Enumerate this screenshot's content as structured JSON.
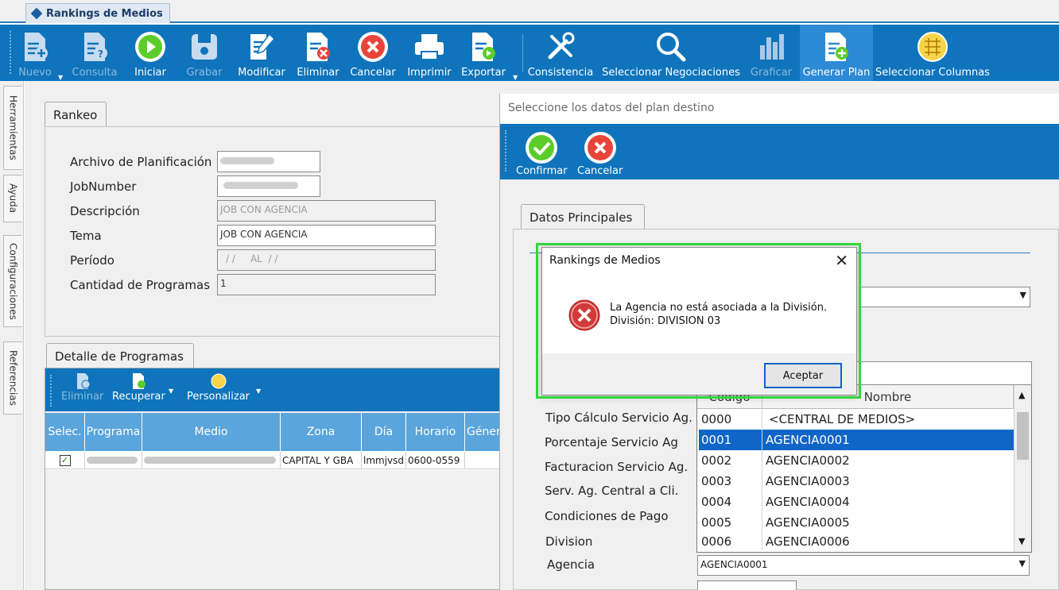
{
  "document_tab": {
    "title": "Rankings de Medios"
  },
  "toolbar": {
    "buttons": [
      {
        "label": "Nuevo",
        "icon": "new-document-icon",
        "enabled": false
      },
      {
        "label": "Consulta",
        "icon": "query-document-icon",
        "enabled": false
      },
      {
        "label": "Iniciar",
        "icon": "play-icon",
        "enabled": true
      },
      {
        "label": "Grabar",
        "icon": "save-disk-icon",
        "enabled": false
      },
      {
        "label": "Modificar",
        "icon": "edit-document-icon",
        "enabled": true
      },
      {
        "label": "Eliminar",
        "icon": "delete-document-icon",
        "enabled": true
      },
      {
        "label": "Cancelar",
        "icon": "cancel-x-icon",
        "enabled": true
      },
      {
        "label": "Imprimir",
        "icon": "printer-icon",
        "enabled": true
      },
      {
        "label": "Exportar",
        "icon": "export-document-icon",
        "enabled": true
      },
      {
        "label": "Consistencia",
        "icon": "tools-icon",
        "enabled": true
      },
      {
        "label": "Seleccionar Negociaciones",
        "icon": "magnifier-icon",
        "enabled": true
      },
      {
        "label": "Graficar",
        "icon": "bar-chart-icon",
        "enabled": false
      },
      {
        "label": "Generar Plan",
        "icon": "generate-plan-icon",
        "enabled": true
      },
      {
        "label": "Seleccionar Columnas",
        "icon": "columns-grid-icon",
        "enabled": true
      }
    ]
  },
  "side_tabs": [
    "Herramientas",
    "Ayuda",
    "Configuraciones",
    "Referencias"
  ],
  "rankeo": {
    "tab_label": "Rankeo",
    "fields": {
      "archivo_label": "Archivo de Planificación",
      "jobnumber_label": "JobNumber",
      "descripcion_label": "Descripción",
      "descripcion_value": "JOB CON AGENCIA",
      "tema_label": "Tema",
      "tema_value": "JOB CON AGENCIA",
      "periodo_label": "Período",
      "periodo_value": "/ /     AL  / /",
      "cantidad_label": "Cantidad de Programas",
      "cantidad_value": "1"
    }
  },
  "detalle": {
    "tab_label": "Detalle de Programas",
    "toolbar": {
      "eliminar": "Eliminar",
      "recuperar": "Recuperar",
      "personalizar": "Personalizar"
    },
    "columns": [
      "Selec.",
      "Programa",
      "Medio",
      "Zona",
      "Día",
      "Horario",
      "Géner"
    ],
    "rows": [
      {
        "zona": "CAPITAL Y GBA",
        "dia": "lmmjvsd",
        "horario": "0600-0559"
      }
    ]
  },
  "plan_window": {
    "title": "Seleccione los datos del plan destino",
    "confirm_label": "Confirmar",
    "cancel_label": "Cancelar",
    "tab_label": "Datos Principales",
    "field_labels": {
      "tipo_calculo": "Tipo Cálculo Servicio Ag.",
      "porcentaje": "Porcentaje Servicio Ag",
      "facturacion": "Facturacion Servicio Ag.",
      "serv_ag_central": "Serv. Ag. Central a Cli.",
      "condiciones": "Condiciones de Pago",
      "division": "Division",
      "agencia": "Agencia"
    },
    "agencia_value": "AGENCIA0001",
    "dropdown": {
      "col_nombre": "Nombre",
      "col_codigo": "Codigo",
      "rows": [
        {
          "codigo": "0000",
          "nombre": "<CENTRAL DE MEDIOS>"
        },
        {
          "codigo": "0001",
          "nombre": "AGENCIA0001",
          "selected": true
        },
        {
          "codigo": "0002",
          "nombre": "AGENCIA0002"
        },
        {
          "codigo": "0003",
          "nombre": "AGENCIA0003"
        },
        {
          "codigo": "0004",
          "nombre": "AGENCIA0004"
        },
        {
          "codigo": "0005",
          "nombre": "AGENCIA0005"
        },
        {
          "codigo": "0006",
          "nombre": "AGENCIA0006"
        }
      ]
    }
  },
  "message_dialog": {
    "title": "Rankings de Medios",
    "line1": "La Agencia no está asociada a la División.",
    "line2": "División: DIVISION 03",
    "ok_label": "Aceptar"
  },
  "colors": {
    "toolbar_blue": "#0f74bb",
    "grid_header": "#5aa5dc",
    "selection": "#1066c8",
    "highlight_green": "#33d63c"
  }
}
